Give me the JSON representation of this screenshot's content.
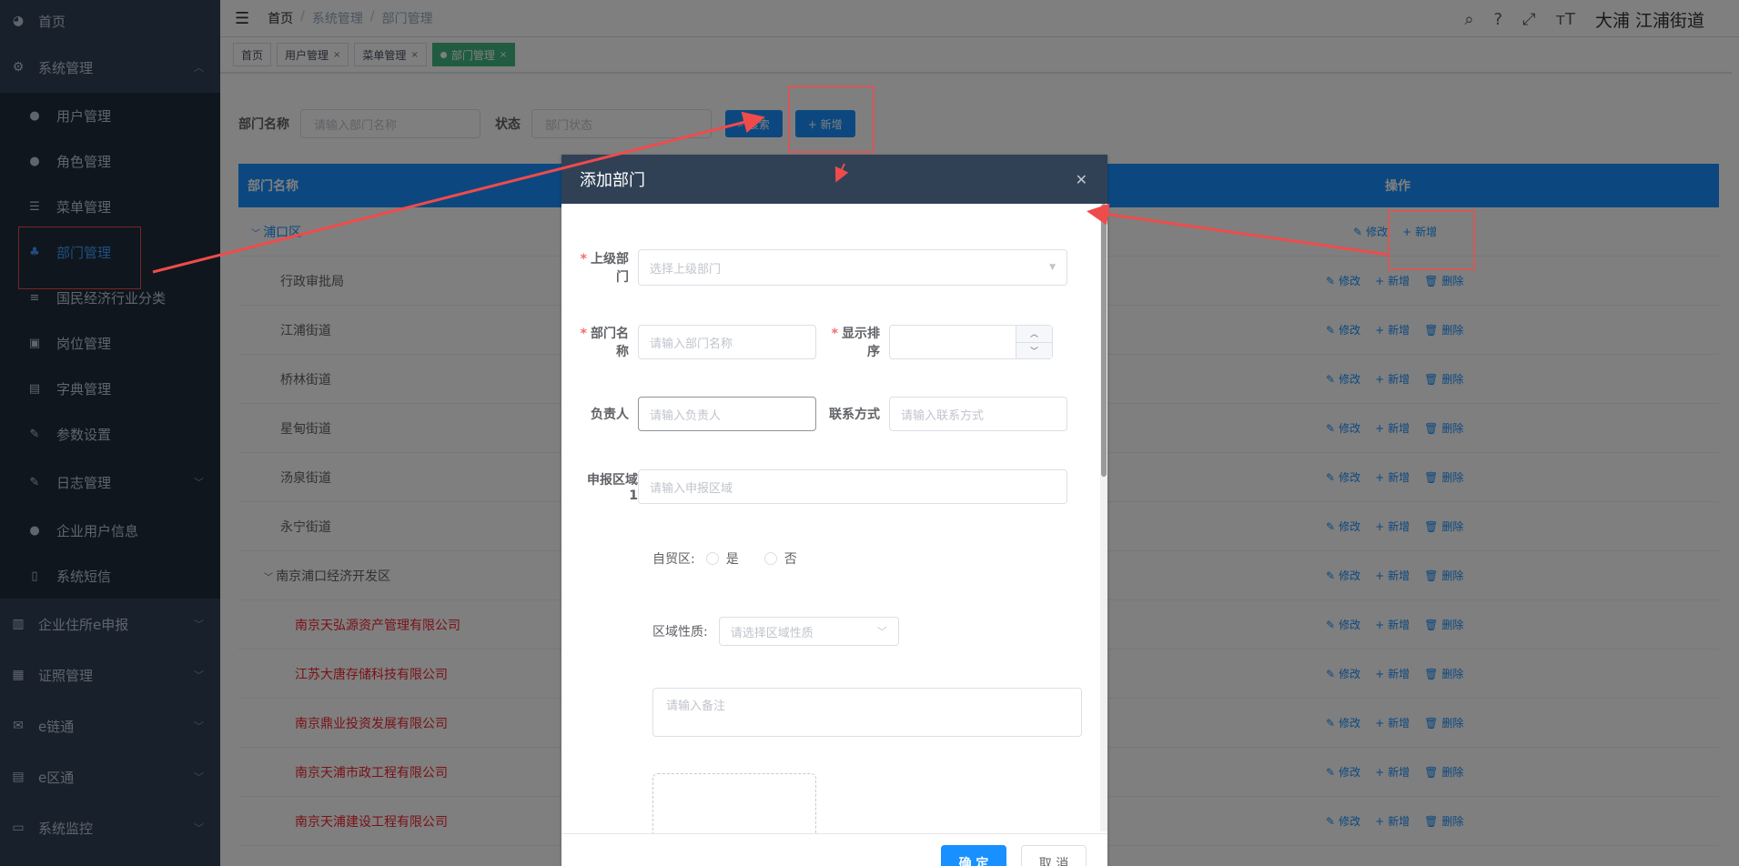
{
  "sidebar": {
    "items": [
      {
        "label": "首页",
        "icon": "dashboard-icon"
      },
      {
        "label": "系统管理",
        "icon": "gear-icon"
      }
    ],
    "sub_items": [
      {
        "label": "用户管理",
        "icon": "user-icon"
      },
      {
        "label": "角色管理",
        "icon": "people-icon"
      },
      {
        "label": "菜单管理",
        "icon": "tree-table-icon"
      },
      {
        "label": "部门管理",
        "icon": "tree-icon"
      },
      {
        "label": "国民经济行业分类",
        "icon": "sliders-icon"
      },
      {
        "label": "岗位管理",
        "icon": "post-icon"
      },
      {
        "label": "字典管理",
        "icon": "dict-icon"
      },
      {
        "label": "参数设置",
        "icon": "edit-icon"
      },
      {
        "label": "日志管理",
        "icon": "log-icon"
      },
      {
        "label": "企业用户信息",
        "icon": "user-icon"
      },
      {
        "label": "系统短信",
        "icon": "phone-icon"
      }
    ],
    "bottom_items": [
      {
        "label": "企业住所e申报",
        "icon": "book-icon"
      },
      {
        "label": "证照管理",
        "icon": "grid-icon"
      },
      {
        "label": "e链通",
        "icon": "mail-icon"
      },
      {
        "label": "e区通",
        "icon": "document-icon"
      },
      {
        "label": "系统监控",
        "icon": "monitor-icon"
      }
    ]
  },
  "navbar": {
    "breadcrumb": [
      "首页",
      "系统管理",
      "部门管理"
    ],
    "user": "大浦  江浦街道"
  },
  "tags": [
    {
      "label": "首页"
    },
    {
      "label": "用户管理"
    },
    {
      "label": "菜单管理"
    },
    {
      "label": "部门管理"
    }
  ],
  "search": {
    "dept_label": "部门名称",
    "dept_placeholder": "请输入部门名称",
    "status_label": "状态",
    "status_placeholder": "部门状态",
    "search_btn": "搜索",
    "add_btn": "+ 新增"
  },
  "table": {
    "col_name": "部门名称",
    "col_ops": "操作",
    "op_edit": "修改",
    "op_add": "新增",
    "op_delete": "删除",
    "rows": [
      {
        "name": "浦口区",
        "indent": 0,
        "expand": true
      },
      {
        "name": "行政审批局",
        "indent": 1
      },
      {
        "name": "江浦街道",
        "indent": 1
      },
      {
        "name": "桥林街道",
        "indent": 1
      },
      {
        "name": "星甸街道",
        "indent": 1
      },
      {
        "name": "汤泉街道",
        "indent": 1
      },
      {
        "name": "永宁街道",
        "indent": 1
      },
      {
        "name": "南京浦口经济开发区",
        "indent": 1,
        "expand": true
      },
      {
        "name": "南京天弘源资产管理有限公司",
        "indent": 2
      },
      {
        "name": "江苏大唐存储科技有限公司",
        "indent": 2
      },
      {
        "name": "南京鼎业投资发展有限公司",
        "indent": 2
      },
      {
        "name": "南京天浦市政工程有限公司",
        "indent": 2
      },
      {
        "name": "南京天浦建设工程有限公司",
        "indent": 2
      }
    ]
  },
  "dialog": {
    "title": "添加部门",
    "parent_label": "上级部门",
    "parent_placeholder": "选择上级部门",
    "name_label": "部门名称",
    "name_placeholder": "请输入部门名称",
    "order_label": "显示排序",
    "leader_label": "负责人",
    "leader_placeholder": "请输入负责人",
    "phone_label": "联系方式",
    "phone_placeholder": "请输入联系方式",
    "area_label": "申报区域1",
    "area_placeholder": "请输入申报区域",
    "ftz_label": "自贸区:",
    "ftz_yes": "是",
    "ftz_no": "否",
    "nature_label": "区域性质:",
    "nature_placeholder": "请选择区域性质",
    "remark_placeholder": "请输入备注",
    "ok": "确 定",
    "cancel": "取 消"
  },
  "colors": {
    "sidebar_bg": "#304156",
    "primary": "#1890ff",
    "active_tag": "#42b983",
    "annotation": "#f04b4b"
  }
}
